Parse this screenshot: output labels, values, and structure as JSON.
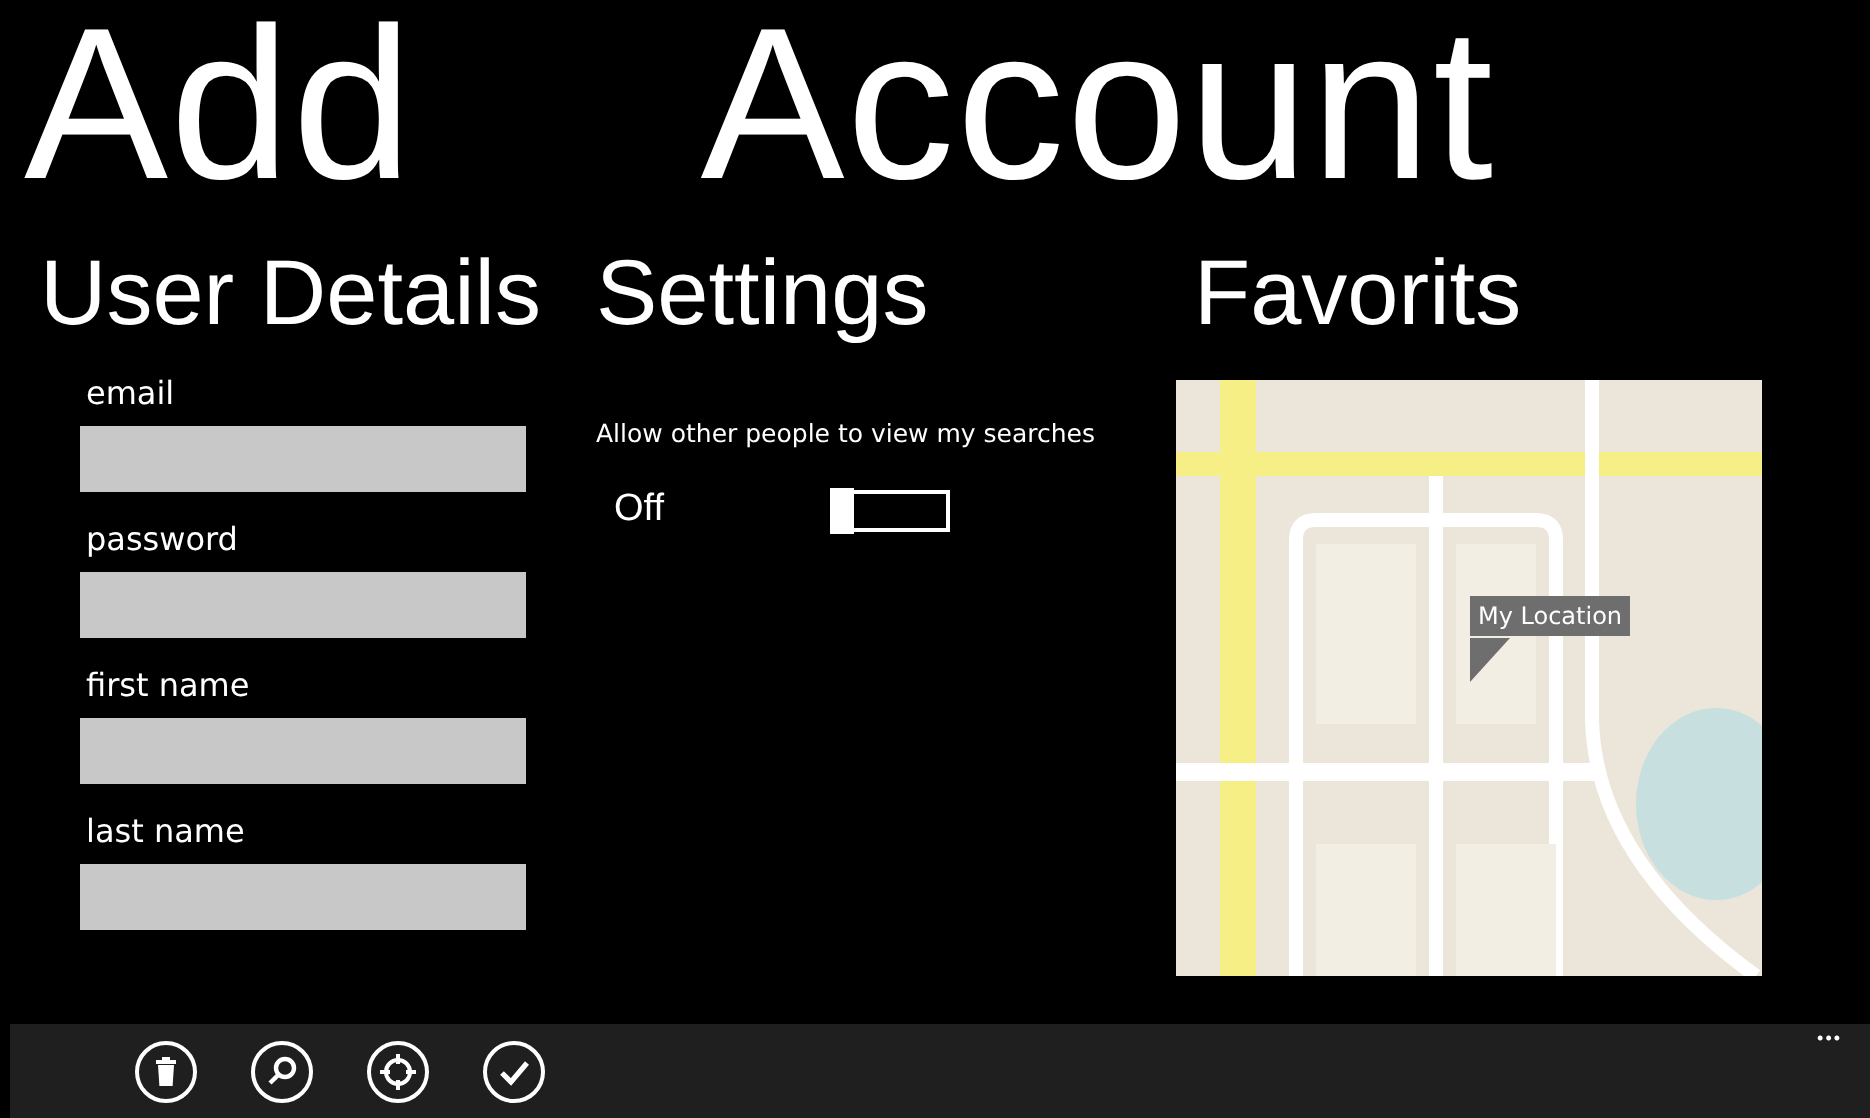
{
  "title": "Add Account",
  "user_details": {
    "heading": "User Details",
    "fields": [
      {
        "label": "email"
      },
      {
        "label": "password"
      },
      {
        "label": "first name"
      },
      {
        "label": "last name"
      }
    ]
  },
  "settings": {
    "heading": "Settings",
    "toggle": {
      "label": "Allow other people to view my searches",
      "state_text": "Off",
      "on": false
    }
  },
  "favorites": {
    "heading": "Favorits",
    "map": {
      "pin_label": "My Location"
    }
  },
  "app_bar": {
    "buttons": [
      {
        "kind": "delete"
      },
      {
        "kind": "search"
      },
      {
        "kind": "locate"
      },
      {
        "kind": "accept"
      }
    ],
    "more": "•••"
  }
}
